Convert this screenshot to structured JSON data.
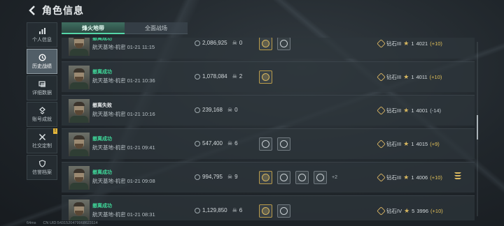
{
  "header": {
    "title": "角色信息"
  },
  "sidebar": {
    "items": [
      {
        "label": "个人信息",
        "icon": "bar-chart-icon",
        "active": false
      },
      {
        "label": "历史战绩",
        "icon": "history-clock-icon",
        "active": true
      },
      {
        "label": "详细数据",
        "icon": "data-cards-icon",
        "active": false
      },
      {
        "label": "账号成就",
        "icon": "achievement-icon",
        "active": false
      },
      {
        "label": "社交定制",
        "icon": "crossed-tools-icon",
        "active": false,
        "badge": "!"
      },
      {
        "label": "信誉档案",
        "icon": "shield-icon",
        "active": false
      }
    ]
  },
  "tabs": [
    {
      "label": "烽火地带",
      "active": true
    },
    {
      "label": "全面战场",
      "active": false
    }
  ],
  "matches": [
    {
      "result": "撤离成功",
      "status": "win",
      "map": "航天基地-机密",
      "date": "01-21 11:15",
      "money": "2,086,925",
      "kills": "0",
      "medals": [
        "gold",
        "normal"
      ],
      "extra": "",
      "rank_name": "钻石III",
      "stars": "1",
      "score": "4021",
      "delta": "(+10)",
      "delta_dir": "up",
      "mvp": false
    },
    {
      "result": "撤离成功",
      "status": "win",
      "map": "航天基地-机密",
      "date": "01-21 10:36",
      "money": "1,078,084",
      "kills": "2",
      "medals": [
        "gold"
      ],
      "extra": "",
      "rank_name": "钻石III",
      "stars": "1",
      "score": "4011",
      "delta": "(+10)",
      "delta_dir": "up",
      "mvp": false
    },
    {
      "result": "撤离失败",
      "status": "lose",
      "map": "航天基地-机密",
      "date": "01-21 10:16",
      "money": "239,168",
      "kills": "0",
      "medals": [],
      "extra": "",
      "rank_name": "钻石III",
      "stars": "1",
      "score": "4001",
      "delta": "(-14)",
      "delta_dir": "down",
      "mvp": false
    },
    {
      "result": "撤离成功",
      "status": "win",
      "map": "航天基地-机密",
      "date": "01-21 09:41",
      "money": "547,400",
      "kills": "6",
      "medals": [
        "normal",
        "normal"
      ],
      "extra": "",
      "rank_name": "钻石III",
      "stars": "1",
      "score": "4015",
      "delta": "(+9)",
      "delta_dir": "up",
      "mvp": false
    },
    {
      "result": "撤离成功",
      "status": "win",
      "map": "航天基地-机密",
      "date": "01-21 09:08",
      "money": "994,795",
      "kills": "9",
      "medals": [
        "gold",
        "normal",
        "normal",
        "normal"
      ],
      "extra": "+2",
      "rank_name": "钻石III",
      "stars": "1",
      "score": "4006",
      "delta": "(+10)",
      "delta_dir": "up",
      "mvp": true
    },
    {
      "result": "撤离成功",
      "status": "win",
      "map": "航天基地-机密",
      "date": "01-21 08:31",
      "money": "1,129,850",
      "kills": "6",
      "medals": [
        "gold",
        "normal"
      ],
      "extra": "",
      "rank_name": "钻石IV",
      "stars": "5",
      "score": "3996",
      "delta": "(+10)",
      "delta_dir": "up",
      "mvp": false
    }
  ],
  "footer": {
    "ping": "64ms",
    "uid": "CN UID:5431520479968623114"
  }
}
